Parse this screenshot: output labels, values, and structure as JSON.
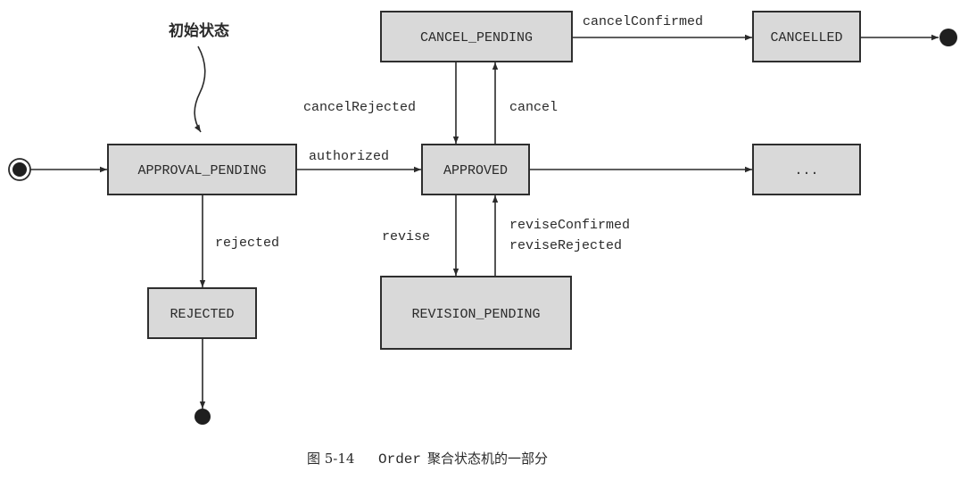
{
  "annotation": {
    "initial_state_label": "初始状态"
  },
  "states": {
    "approval_pending": "APPROVAL_PENDING",
    "approved": "APPROVED",
    "cancel_pending": "CANCEL_PENDING",
    "cancelled": "CANCELLED",
    "rejected": "REJECTED",
    "revision_pending": "REVISION_PENDING",
    "more": "..."
  },
  "transitions": {
    "authorized": "authorized",
    "rejected": "rejected",
    "cancel": "cancel",
    "cancel_rejected": "cancelRejected",
    "cancel_confirmed": "cancelConfirmed",
    "revise": "revise",
    "revise_confirmed": "reviseConfirmed",
    "revise_rejected": "reviseRejected"
  },
  "caption": {
    "figure_number": "图 5-14",
    "entity": "Order",
    "text": "聚合状态机的一部分"
  }
}
